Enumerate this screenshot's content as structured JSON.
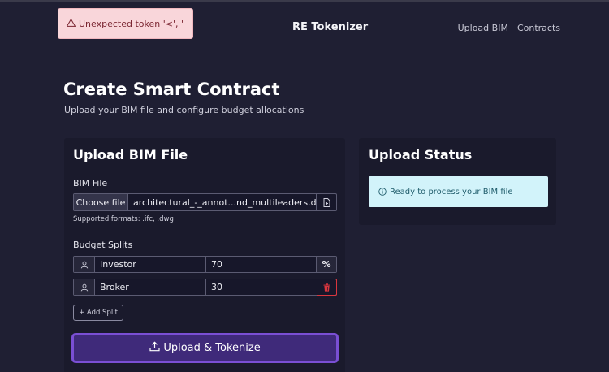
{
  "toast": {
    "icon": "warning-icon",
    "text": "Unexpected token '<', \""
  },
  "header": {
    "title": "RE Tokenizer",
    "nav": [
      {
        "label": "Upload BIM"
      },
      {
        "label": "Contracts"
      }
    ]
  },
  "page": {
    "title": "Create Smart Contract",
    "subtitle": "Upload your BIM file and configure budget allocations"
  },
  "upload_card": {
    "title": "Upload BIM File",
    "file_label": "BIM File",
    "choose_label": "Choose file",
    "file_name": "architectural_-_annot...nd_multileaders.dwg",
    "hint": "Supported formats: .ifc, .dwg",
    "splits_label": "Budget Splits",
    "splits": [
      {
        "name": "Investor",
        "percent": "70",
        "action": "%"
      },
      {
        "name": "Broker",
        "percent": "30",
        "action": "trash-icon"
      }
    ],
    "add_split_label": "+ Add Split",
    "submit_label": "Upload & Tokenize"
  },
  "status_card": {
    "title": "Upload Status",
    "message": "Ready to process your BIM file"
  },
  "colors": {
    "background": "#1f1f33",
    "card": "#1a1a2c",
    "accent": "#7a4fd4",
    "danger": "#d9363e",
    "info_bg": "#d2f3fa",
    "error_bg": "#f9d6da"
  }
}
